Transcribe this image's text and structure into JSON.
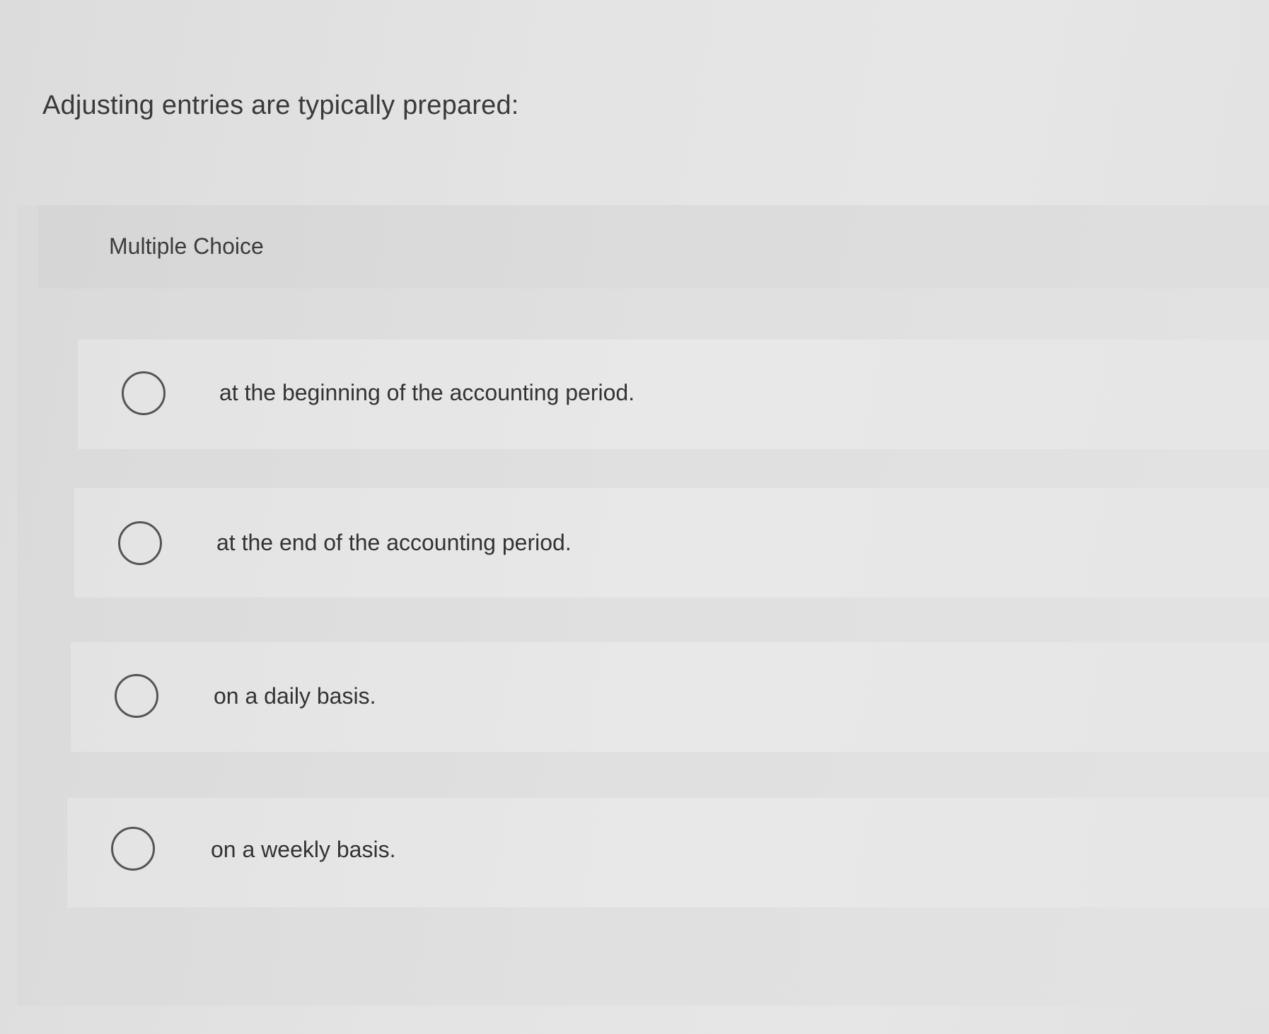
{
  "question": {
    "text": "Adjusting entries are typically prepared:"
  },
  "panel": {
    "label": "Multiple Choice"
  },
  "options": [
    {
      "label": "at the beginning of the accounting period.",
      "selected": false
    },
    {
      "label": "at the end of the accounting period.",
      "selected": false
    },
    {
      "label": "on a daily basis.",
      "selected": false
    },
    {
      "label": "on a weekly basis.",
      "selected": false
    }
  ]
}
